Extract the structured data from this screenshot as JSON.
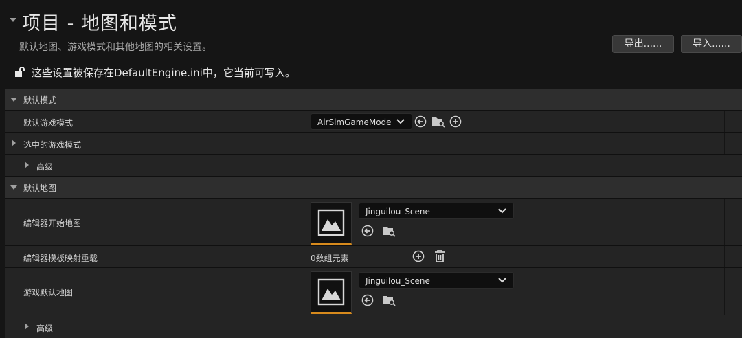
{
  "header": {
    "title": "项目 - 地图和模式",
    "subtitle": "默认地图、游戏模式和其他地图的相关设置。",
    "export_label": "导出......",
    "import_label": "导入......",
    "notice": "这些设置被保存在DefaultEngine.ini中，它当前可写入。"
  },
  "sections": {
    "default_modes": {
      "label": "默认模式",
      "default_game_mode_label": "默认游戏模式",
      "default_game_mode_value": "AirSimGameMode",
      "selected_game_mode_label": "选中的游戏模式",
      "advanced_label": "高级"
    },
    "default_maps": {
      "label": "默认地图",
      "editor_startup_map_label": "编辑器开始地图",
      "editor_startup_map_value": "Jinguilou_Scene",
      "template_override_label": "编辑器模板映射重载",
      "template_override_value": "0数组元素",
      "game_default_map_label": "游戏默认地图",
      "game_default_map_value": "Jinguilou_Scene",
      "advanced_label": "高级"
    }
  },
  "colors": {
    "accent_orange": "#d78a1d"
  }
}
